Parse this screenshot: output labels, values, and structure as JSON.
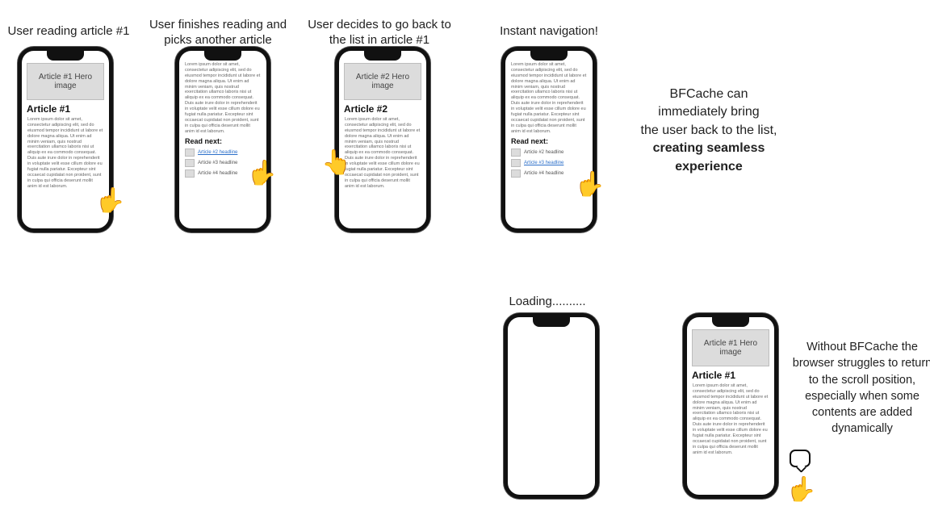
{
  "captions": {
    "c1": "User reading article #1",
    "c2": "User finishes reading and picks another article",
    "c3": "User decides to go back to the list in article #1",
    "c4": "Instant navigation!",
    "c5": "Loading.........."
  },
  "side1_l1": "BFCache can",
  "side1_l2": "immediately bring",
  "side1_l3": "the user back to the list,",
  "side1_l4": "creating seamless",
  "side1_l5": "experience",
  "side2_l1": "Without BFCache the",
  "side2_l2": "browser struggles to return",
  "side2_l3": "to the scroll position,",
  "side2_l4": "especially when some",
  "side2_l5": "contents are added",
  "side2_l6": "dynamically",
  "hero1": "Article #1 Hero image",
  "hero2": "Article #2 Hero image",
  "title1": "Article #1",
  "title2": "Article #2",
  "readnext": "Read next:",
  "rn_a2": "Article #2 headline",
  "rn_a3": "Article #3 headline",
  "rn_a4": "Article #4 headline",
  "lorem": "Lorem ipsum dolor sit amet, consectetur adipiscing elit, sed do eiusmod tempor incididunt ut labore et dolore magna aliqua. Ut enim ad minim veniam, quis nostrud exercitation ullamco laboris nisi ut aliquip ex ea commodo consequat. Duis aute irure dolor in reprehenderit in voluptate velit esse cillum dolore eu fugiat nulla pariatur. Excepteur sint occaecat cupidatat non proident, sunt in culpa qui officia deserunt mollit anim id est laborum.",
  "hand": "👆"
}
